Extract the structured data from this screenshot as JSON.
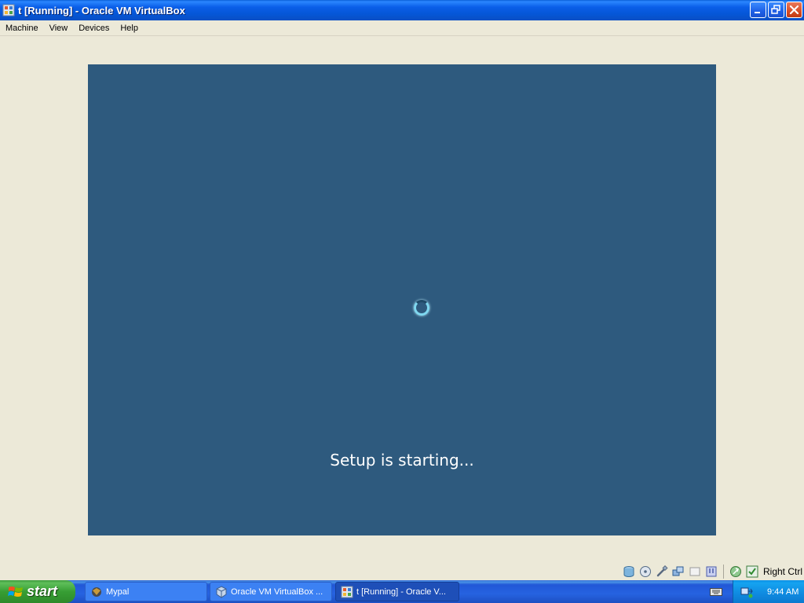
{
  "window": {
    "title": "t [Running] - Oracle VM VirtualBox"
  },
  "menu": {
    "items": [
      "Machine",
      "View",
      "Devices",
      "Help"
    ]
  },
  "vm": {
    "background_color": "#2e5a7e",
    "setup_text": "Setup is starting...",
    "spinner": "loading-spinner"
  },
  "statusbar": {
    "icons": [
      "hard-disk-icon",
      "optical-drive-icon",
      "usb-icon",
      "network-icon",
      "shared-folders-icon",
      "vrdp-icon",
      "virtualization-icon",
      "mouse-integration-icon"
    ],
    "host_key": "Right Ctrl"
  },
  "taskbar": {
    "start_label": "start",
    "tasks": [
      {
        "label": "Mypal",
        "icon": "mypal-icon"
      },
      {
        "label": "Oracle VM VirtualBox ...",
        "icon": "virtualbox-icon"
      },
      {
        "label": "t [Running] - Oracle V...",
        "icon": "vm-window-icon",
        "active": true
      }
    ],
    "clock": "9:44 AM"
  }
}
